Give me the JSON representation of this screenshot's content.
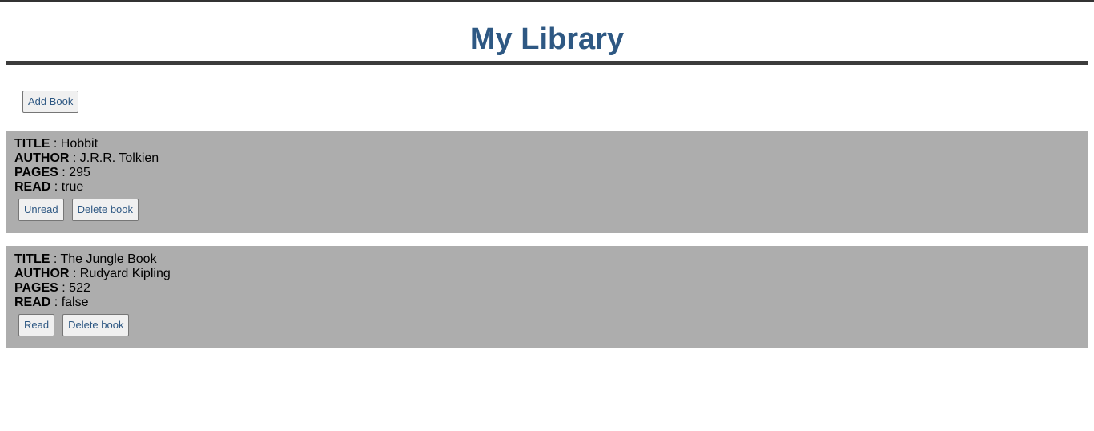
{
  "header": {
    "title": "My Library"
  },
  "toolbar": {
    "add_label": "Add Book"
  },
  "labels": {
    "title": "TITLE",
    "author": "AUTHOR",
    "pages": "PAGES",
    "read": "READ",
    "separator": " : "
  },
  "books": [
    {
      "title": "Hobbit",
      "author": "J.R.R. Tolkien",
      "pages": "295",
      "read": "true",
      "toggle_label": "Unread",
      "delete_label": "Delete book"
    },
    {
      "title": "The Jungle Book",
      "author": "Rudyard Kipling",
      "pages": "522",
      "read": "false",
      "toggle_label": "Read",
      "delete_label": "Delete book"
    }
  ],
  "colors": {
    "title": "#2e5883",
    "card_bg": "#adadad",
    "rule": "#3c3c3c"
  }
}
